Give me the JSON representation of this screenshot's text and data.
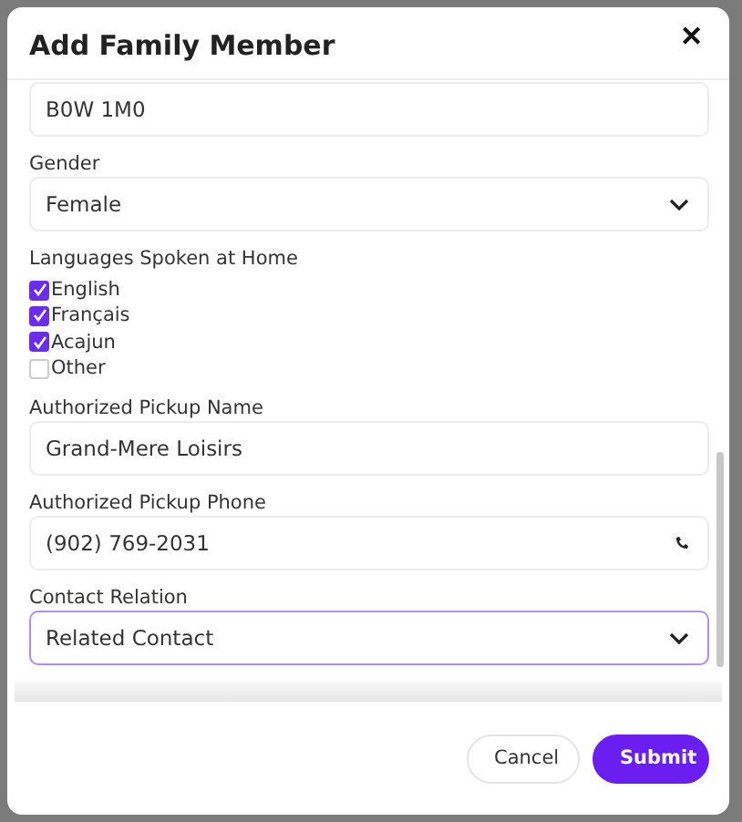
{
  "dialog": {
    "title": "Add Family Member",
    "close": "✕"
  },
  "fields": [
    {
      "kind": "text",
      "value": "B0W 1M0",
      "focused": false
    },
    {
      "kind": "select",
      "label": "Gender",
      "value": "Female",
      "focused": false
    },
    {
      "kind": "checkboxes",
      "label": "Languages Spoken at Home",
      "options": [
        {
          "label": "English",
          "checked": true
        },
        {
          "label": "Français",
          "checked": true
        },
        {
          "label": "Acajun",
          "checked": true
        },
        {
          "label": "Other",
          "checked": false
        }
      ]
    },
    {
      "kind": "text",
      "label": "Authorized Pickup Name",
      "value": "Grand-Mere Loisirs",
      "focused": false
    },
    {
      "kind": "phone",
      "label": "Authorized Pickup Phone",
      "value": "(902) 769-2031",
      "focused": false
    },
    {
      "kind": "select",
      "label": "Contact Relation",
      "value": "Related Contact",
      "focused": true
    }
  ],
  "buttons": [
    {
      "label": "Cancel",
      "kind": "secondary"
    },
    {
      "label": "Submit",
      "kind": "primary"
    }
  ]
}
